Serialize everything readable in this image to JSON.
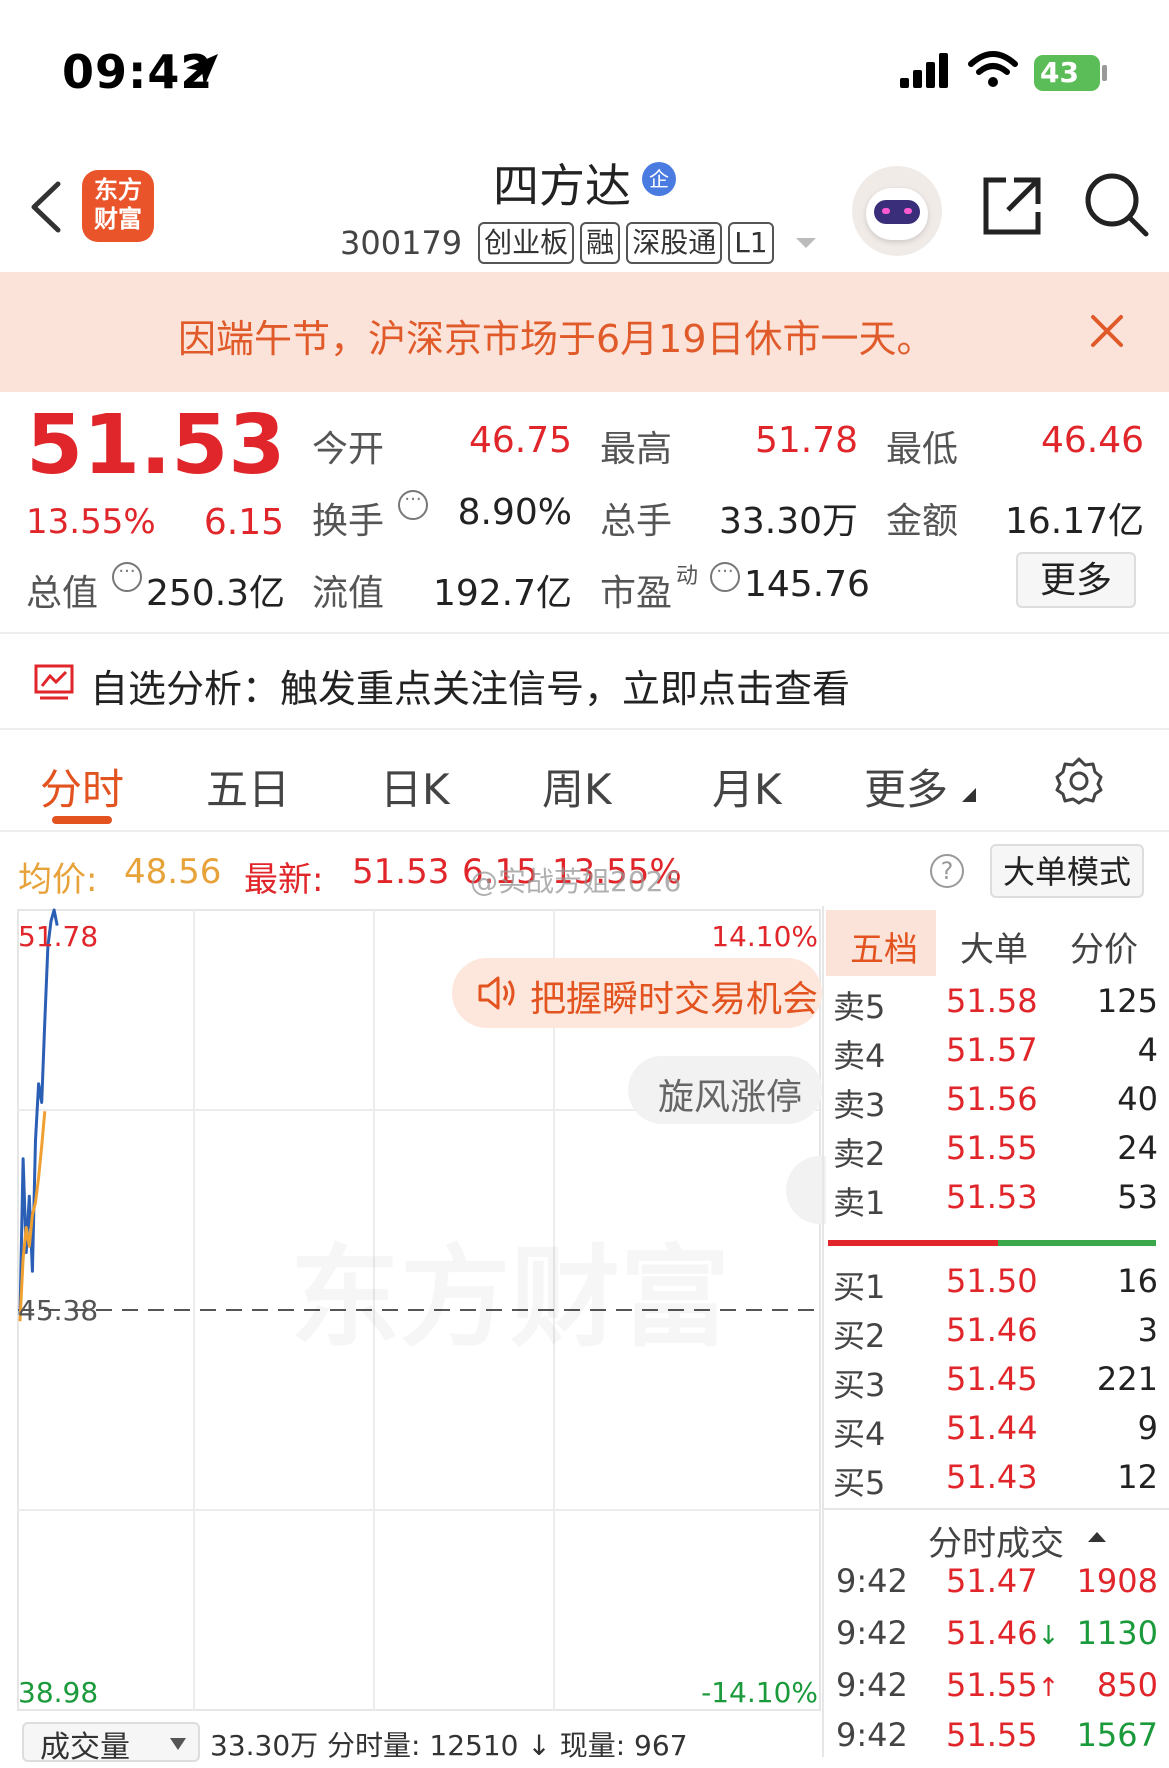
{
  "status_bar": {
    "time": "09:42",
    "battery": "43"
  },
  "header": {
    "logo_text_1": "东方",
    "logo_text_2": "财富",
    "stock_name": "四方达",
    "badge": "企",
    "code": "300179",
    "tags": [
      "创业板",
      "融",
      "深股通",
      "L1"
    ]
  },
  "notice": {
    "text": "因端午节，沪深京市场于6月19日休市一天。"
  },
  "quote": {
    "price": "51.53",
    "change_pct": "13.55%",
    "change": "6.15",
    "open_label": "今开",
    "open": "46.75",
    "high_label": "最高",
    "high": "51.78",
    "low_label": "最低",
    "low": "46.46",
    "turnover_label": "换手",
    "turnover": "8.90%",
    "volume_label": "总手",
    "volume": "33.30万",
    "amount_label": "金额",
    "amount": "16.17亿",
    "mktcap_label": "总值",
    "mktcap": "250.3亿",
    "float_label": "流值",
    "float": "192.7亿",
    "pe_label": "市盈",
    "pe_sup": "动",
    "pe": "145.76",
    "more_button": "更多"
  },
  "analysis": {
    "text": "自选分析：触发重点关注信号，立即点击查看"
  },
  "tabs": [
    "分时",
    "五日",
    "日K",
    "周K",
    "月K",
    "更多"
  ],
  "chart_info": {
    "avg_label": "均价:",
    "avg": "48.56",
    "latest_label": "最新:",
    "latest": "51.53",
    "latest_change": "6.15",
    "latest_pct": "13.55%",
    "watermark": "@实战芳姐2026",
    "bigorder_button": "大单模式"
  },
  "chart_overlay": {
    "promo": "把握瞬时交易机会",
    "pill": "旋风涨停",
    "bg_watermark": "东方财富"
  },
  "chart_data": {
    "type": "line",
    "y_left_ticks": [
      "51.78",
      "45.38",
      "38.98"
    ],
    "y_right_ticks": [
      "14.10%",
      "-14.10%"
    ],
    "ylim": [
      38.98,
      51.78
    ],
    "prev_close": 45.38,
    "series": [
      {
        "name": "",
        "color": "#2b5fb5",
        "values": [
          45.3,
          47.8,
          46.3,
          47.2,
          46.0,
          48.1,
          49.0,
          48.7,
          50.0,
          51.2,
          51.6,
          51.78,
          51.53
        ]
      },
      {
        "name": "",
        "color": "#f0a030",
        "values": [
          45.2,
          46.2,
          46.7,
          46.4,
          46.9,
          47.1,
          47.5,
          48.0,
          48.56
        ]
      }
    ]
  },
  "order_book": {
    "tabs": [
      "五档",
      "大单",
      "分价"
    ],
    "sells": [
      {
        "label": "卖5",
        "price": "51.58",
        "vol": "125"
      },
      {
        "label": "卖4",
        "price": "51.57",
        "vol": "4"
      },
      {
        "label": "卖3",
        "price": "51.56",
        "vol": "40"
      },
      {
        "label": "卖2",
        "price": "51.55",
        "vol": "24"
      },
      {
        "label": "卖1",
        "price": "51.53",
        "vol": "53"
      }
    ],
    "buys": [
      {
        "label": "买1",
        "price": "51.50",
        "vol": "16"
      },
      {
        "label": "买2",
        "price": "51.46",
        "vol": "3"
      },
      {
        "label": "买3",
        "price": "51.45",
        "vol": "221"
      },
      {
        "label": "买4",
        "price": "51.44",
        "vol": "9"
      },
      {
        "label": "买5",
        "price": "51.43",
        "vol": "12"
      }
    ],
    "trades_title": "分时成交",
    "trades": [
      {
        "time": "9:42",
        "price": "51.47",
        "arrow": "",
        "vol": "1908",
        "vol_color": "#e0262a"
      },
      {
        "time": "9:42",
        "price": "51.46",
        "arrow": "↓",
        "vol": "1130",
        "vol_color": "#1a9a3a"
      },
      {
        "time": "9:42",
        "price": "51.55",
        "arrow": "↑",
        "vol": "850",
        "vol_color": "#e0262a"
      },
      {
        "time": "9:42",
        "price": "51.55",
        "arrow": "",
        "vol": "1567",
        "vol_color": "#1a9a3a"
      }
    ]
  },
  "volume_bar": {
    "select": "成交量",
    "summary": "33.30万 分时量: 12510 ↓ 现量: 967"
  },
  "colors": {
    "up": "#e0262a",
    "down": "#1a9a3a",
    "accent": "#e2531f",
    "notice_bg": "#fbe3d9"
  }
}
